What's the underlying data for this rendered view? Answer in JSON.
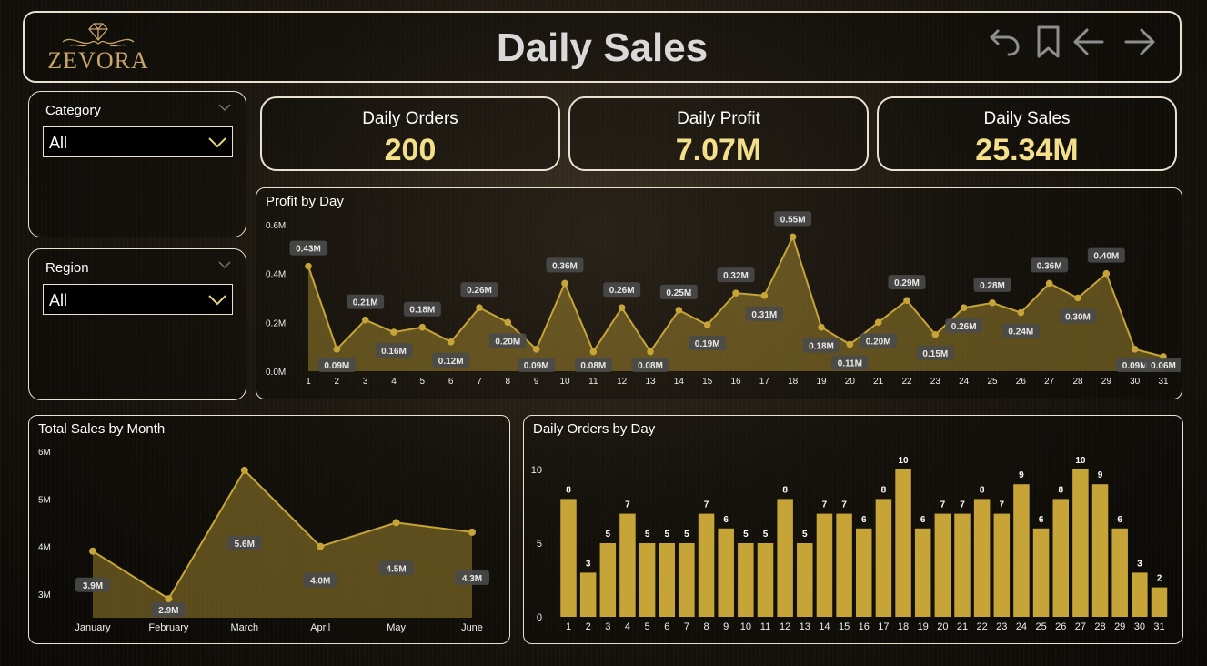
{
  "header": {
    "logo_text": "ZEVORA",
    "title": "Daily Sales",
    "icons": [
      "undo-icon",
      "bookmark-icon",
      "back-arrow-icon",
      "forward-arrow-icon"
    ]
  },
  "filters": {
    "category": {
      "label": "Category",
      "value": "All"
    },
    "region": {
      "label": "Region",
      "value": "All"
    }
  },
  "kpis": {
    "orders": {
      "label": "Daily Orders",
      "value": "200"
    },
    "profit": {
      "label": "Daily Profit",
      "value": "7.07M"
    },
    "sales": {
      "label": "Daily Sales",
      "value": "25.34M"
    }
  },
  "colors": {
    "accent": "#c6a437",
    "kpi_value": "#f4e08a",
    "label_box": "#4a4a4a"
  },
  "chart_data": [
    {
      "id": "profit",
      "type": "area",
      "title": "Profit by Day",
      "x": [
        1,
        2,
        3,
        4,
        5,
        6,
        7,
        8,
        9,
        10,
        11,
        12,
        13,
        14,
        15,
        16,
        17,
        18,
        19,
        20,
        21,
        22,
        23,
        24,
        25,
        26,
        27,
        28,
        29,
        30,
        31
      ],
      "values": [
        0.43,
        0.09,
        0.21,
        0.16,
        0.18,
        0.12,
        0.26,
        0.2,
        0.09,
        0.36,
        0.08,
        0.26,
        0.08,
        0.25,
        0.19,
        0.32,
        0.31,
        0.55,
        0.18,
        0.11,
        0.2,
        0.29,
        0.15,
        0.26,
        0.28,
        0.24,
        0.36,
        0.3,
        0.4,
        0.09,
        0.06
      ],
      "labels": [
        "0.43M",
        "0.09M",
        "0.21M",
        "0.16M",
        "0.18M",
        "0.12M",
        "0.26M",
        "0.20M",
        "0.09M",
        "0.36M",
        "0.08M",
        "0.26M",
        "0.08M",
        "0.25M",
        "0.19M",
        "0.32M",
        "0.31M",
        "0.55M",
        "0.18M",
        "0.11M",
        "0.20M",
        "0.29M",
        "0.15M",
        "0.26M",
        "0.28M",
        "0.24M",
        "0.36M",
        "0.30M",
        "0.40M",
        "0.09M",
        "0.06M"
      ],
      "ylim": [
        0,
        0.6
      ],
      "yticks": [
        "0.0M",
        "0.2M",
        "0.4M",
        "0.6M"
      ],
      "grid": false
    },
    {
      "id": "sales_month",
      "type": "area",
      "title": "Total Sales by Month",
      "categories": [
        "January",
        "February",
        "March",
        "April",
        "May",
        "June"
      ],
      "values": [
        3.9,
        2.9,
        5.6,
        4.0,
        4.5,
        4.3
      ],
      "labels": [
        "3.9M",
        "2.9M",
        "5.6M",
        "4.0M",
        "4.5M",
        "4.3M"
      ],
      "ylim": [
        2.5,
        6
      ],
      "yticks": [
        "3M",
        "4M",
        "5M",
        "6M"
      ],
      "grid": false
    },
    {
      "id": "orders",
      "type": "bar",
      "title": "Daily Orders by Day",
      "x": [
        1,
        2,
        3,
        4,
        5,
        6,
        7,
        8,
        9,
        10,
        11,
        12,
        13,
        14,
        15,
        16,
        17,
        18,
        19,
        20,
        21,
        22,
        23,
        24,
        25,
        26,
        27,
        28,
        29,
        30,
        31
      ],
      "values": [
        8,
        3,
        5,
        7,
        5,
        5,
        5,
        7,
        6,
        5,
        5,
        8,
        5,
        7,
        7,
        6,
        8,
        10,
        6,
        7,
        7,
        8,
        7,
        9,
        6,
        8,
        10,
        9,
        6,
        3,
        2
      ],
      "ylim": [
        0,
        10
      ],
      "yticks": [
        "0",
        "5",
        "10"
      ],
      "grid": false
    }
  ]
}
